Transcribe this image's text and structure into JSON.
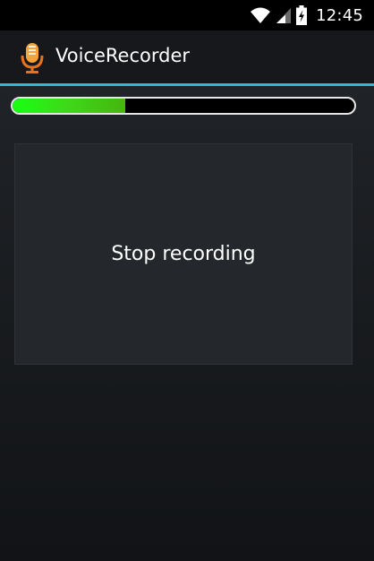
{
  "status_bar": {
    "time": "12:45",
    "icons": [
      "wifi-icon",
      "signal-icon",
      "battery-charging-icon"
    ]
  },
  "action_bar": {
    "app_icon": "microphone-icon",
    "title": "VoiceRecorder",
    "accent_color": "#33b5e5"
  },
  "recording": {
    "progress": 0.33,
    "progress_color": "#2ed616",
    "button_label": "Stop recording"
  }
}
